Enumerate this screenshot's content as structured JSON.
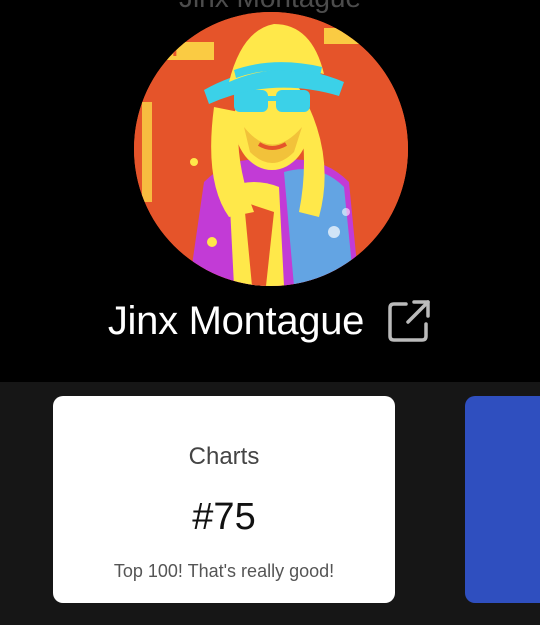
{
  "header": {
    "ghost_title": "Jinx Montague"
  },
  "artist": {
    "name": "Jinx Montague",
    "avatar_icon": "artist-photo",
    "link_icon": "external-link-icon"
  },
  "card": {
    "title": "Charts",
    "value": "#75",
    "subtitle": "Top 100! That's really good!"
  },
  "colors": {
    "background": "#000000",
    "cards_area": "#161616",
    "card": "#ffffff",
    "next_card": "#2f4fbf"
  }
}
